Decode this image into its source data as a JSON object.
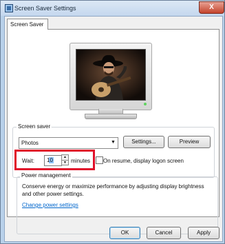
{
  "window": {
    "title": "Screen Saver Settings",
    "close_label": "X"
  },
  "tabs": [
    {
      "label": "Screen Saver",
      "selected": true
    }
  ],
  "preview": {
    "image": "man-in-cowboy-hat-with-guitar"
  },
  "screen_saver": {
    "group_label": "Screen saver",
    "selected": "Photos",
    "settings_button": "Settings...",
    "preview_button": "Preview",
    "wait_label": "Wait:",
    "wait_value": "10",
    "minutes_label": "minutes",
    "resume_checked": false,
    "resume_label": "On resume, display logon screen"
  },
  "power": {
    "group_label": "Power management",
    "description": "Conserve energy or maximize performance by adjusting display brightness and other power settings.",
    "link": "Change power settings"
  },
  "buttons": {
    "ok": "OK",
    "cancel": "Cancel",
    "apply": "Apply"
  },
  "colors": {
    "highlight": "#e0102a",
    "link": "#0066cc"
  }
}
